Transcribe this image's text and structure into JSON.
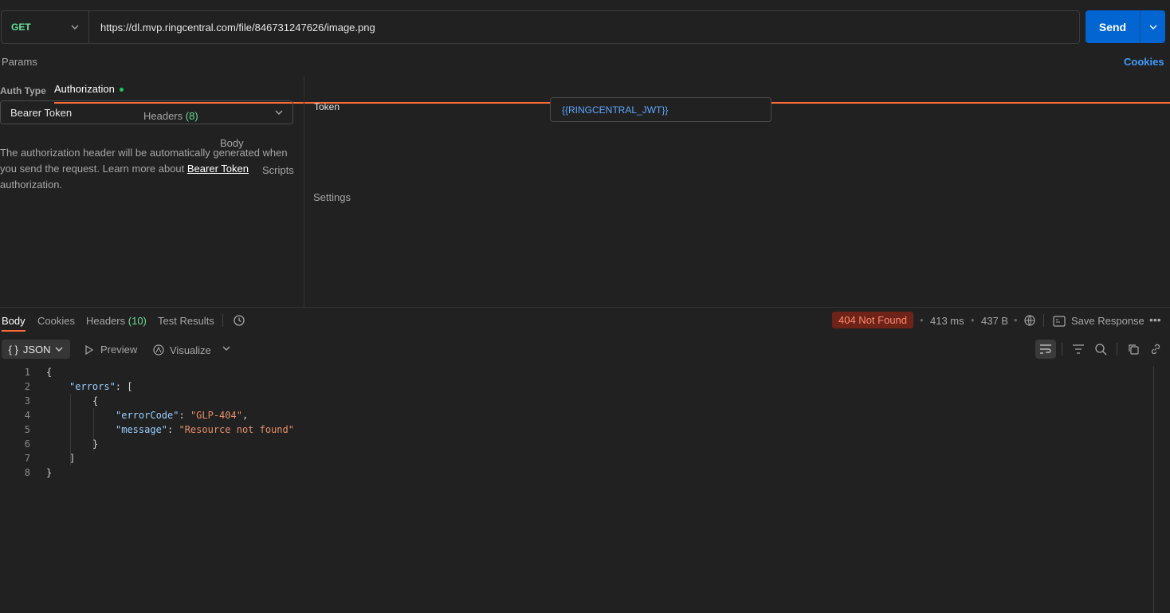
{
  "request": {
    "method": "GET",
    "url": "https://dl.mvp.ringcentral.com/file/846731247626/image.png",
    "send_label": "Send"
  },
  "request_tabs": {
    "params": "Params",
    "authorization": "Authorization",
    "headers": "Headers",
    "headers_count": "(8)",
    "body": "Body",
    "scripts": "Scripts",
    "settings": "Settings",
    "cookies": "Cookies"
  },
  "auth": {
    "type_label": "Auth Type",
    "type_value": "Bearer Token",
    "description_1": "The authorization header will be automatically generated when you send the request. Learn more about ",
    "description_link": "Bearer Token",
    "description_2": " authorization.",
    "token_label": "Token",
    "token_value": "{{RINGCENTRAL_JWT}}"
  },
  "response_tabs": {
    "body": "Body",
    "cookies": "Cookies",
    "headers": "Headers",
    "headers_count": "(10)",
    "test_results": "Test Results"
  },
  "response_meta": {
    "status": "404 Not Found",
    "time": "413 ms",
    "size": "437 B",
    "save_response": "Save Response"
  },
  "body_toolbar": {
    "format": "JSON",
    "preview": "Preview",
    "visualize": "Visualize"
  },
  "code_lines": [
    {
      "n": "1"
    },
    {
      "n": "2",
      "key": "\"errors\"",
      "rest": ": ["
    },
    {
      "n": "3"
    },
    {
      "n": "4",
      "key": "\"errorCode\"",
      "sep": ": ",
      "val": "\"GLP-404\"",
      "tail": ","
    },
    {
      "n": "5",
      "key": "\"message\"",
      "sep": ": ",
      "val": "\"Resource not found\""
    },
    {
      "n": "6"
    },
    {
      "n": "7"
    },
    {
      "n": "8"
    }
  ],
  "colors": {
    "accent": "#ff6c37",
    "send": "#0265d2",
    "method": "#6bdd9a",
    "error_badge": "#6d2317"
  }
}
